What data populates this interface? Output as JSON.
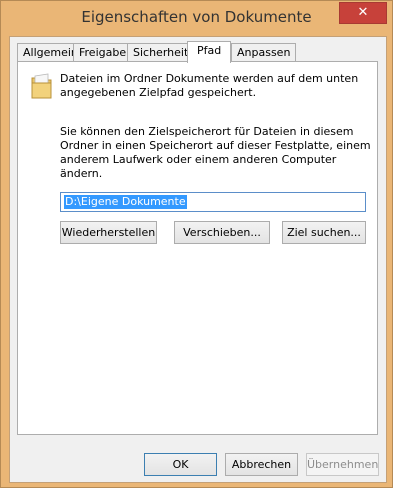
{
  "window": {
    "title": "Eigenschaften von Dokumente",
    "close_glyph": "✕"
  },
  "tabs": [
    {
      "label": "Allgemein",
      "active": false
    },
    {
      "label": "Freigabe",
      "active": false
    },
    {
      "label": "Sicherheit",
      "active": false
    },
    {
      "label": "Pfad",
      "active": true
    },
    {
      "label": "Anpassen",
      "active": false
    }
  ],
  "panel": {
    "description": "Dateien im Ordner Dokumente werden auf dem unten angegebenen Zielpfad gespeichert.",
    "info": "Sie können den Zielspeicherort für Dateien in diesem Ordner in einen Speicherort auf dieser Festplatte, einem anderem Laufwerk oder einem anderen Computer ändern.",
    "path_value": "D:\\Eigene Dokumente",
    "restore_label": "Wiederherstellen",
    "move_label": "Verschieben...",
    "find_target_label": "Ziel suchen..."
  },
  "footer": {
    "ok_label": "OK",
    "cancel_label": "Abbrechen",
    "apply_label": "Übernehmen"
  },
  "icons": {
    "folder": "folder-icon",
    "close": "close-icon"
  }
}
